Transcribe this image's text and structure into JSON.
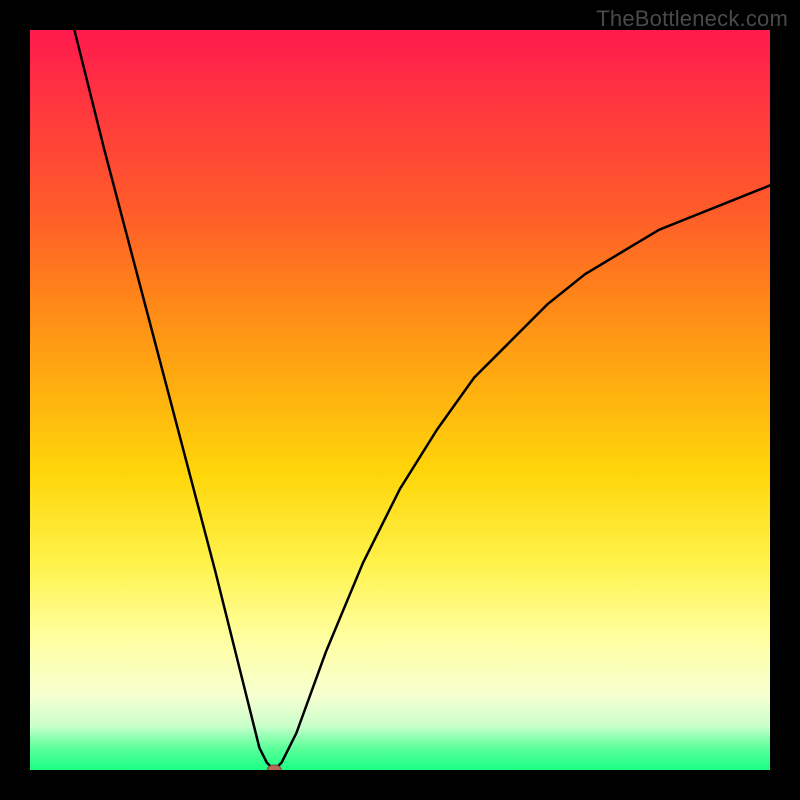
{
  "watermark": "TheBottleneck.com",
  "colors": {
    "frame": "#000000",
    "gradient_top": "#ff1a4d",
    "gradient_bottom": "#18ff84",
    "curve": "#000000",
    "marker": "#b56a5a"
  },
  "chart_data": {
    "type": "line",
    "title": "",
    "xlabel": "",
    "ylabel": "",
    "xlim": [
      0,
      100
    ],
    "ylim": [
      0,
      100
    ],
    "grid": false,
    "legend": false,
    "annotations": [
      "TheBottleneck.com"
    ],
    "series": [
      {
        "name": "curve",
        "x": [
          6,
          10,
          15,
          20,
          25,
          28,
          30,
          31,
          32,
          33,
          34,
          36,
          40,
          45,
          50,
          55,
          60,
          65,
          70,
          75,
          80,
          85,
          90,
          95,
          100
        ],
        "y": [
          100,
          84,
          65,
          46,
          27,
          15,
          7,
          3,
          1,
          0,
          1,
          5,
          16,
          28,
          38,
          46,
          53,
          58,
          63,
          67,
          70,
          73,
          75,
          77,
          79
        ]
      }
    ],
    "marker": {
      "x": 33,
      "y": 0
    }
  }
}
